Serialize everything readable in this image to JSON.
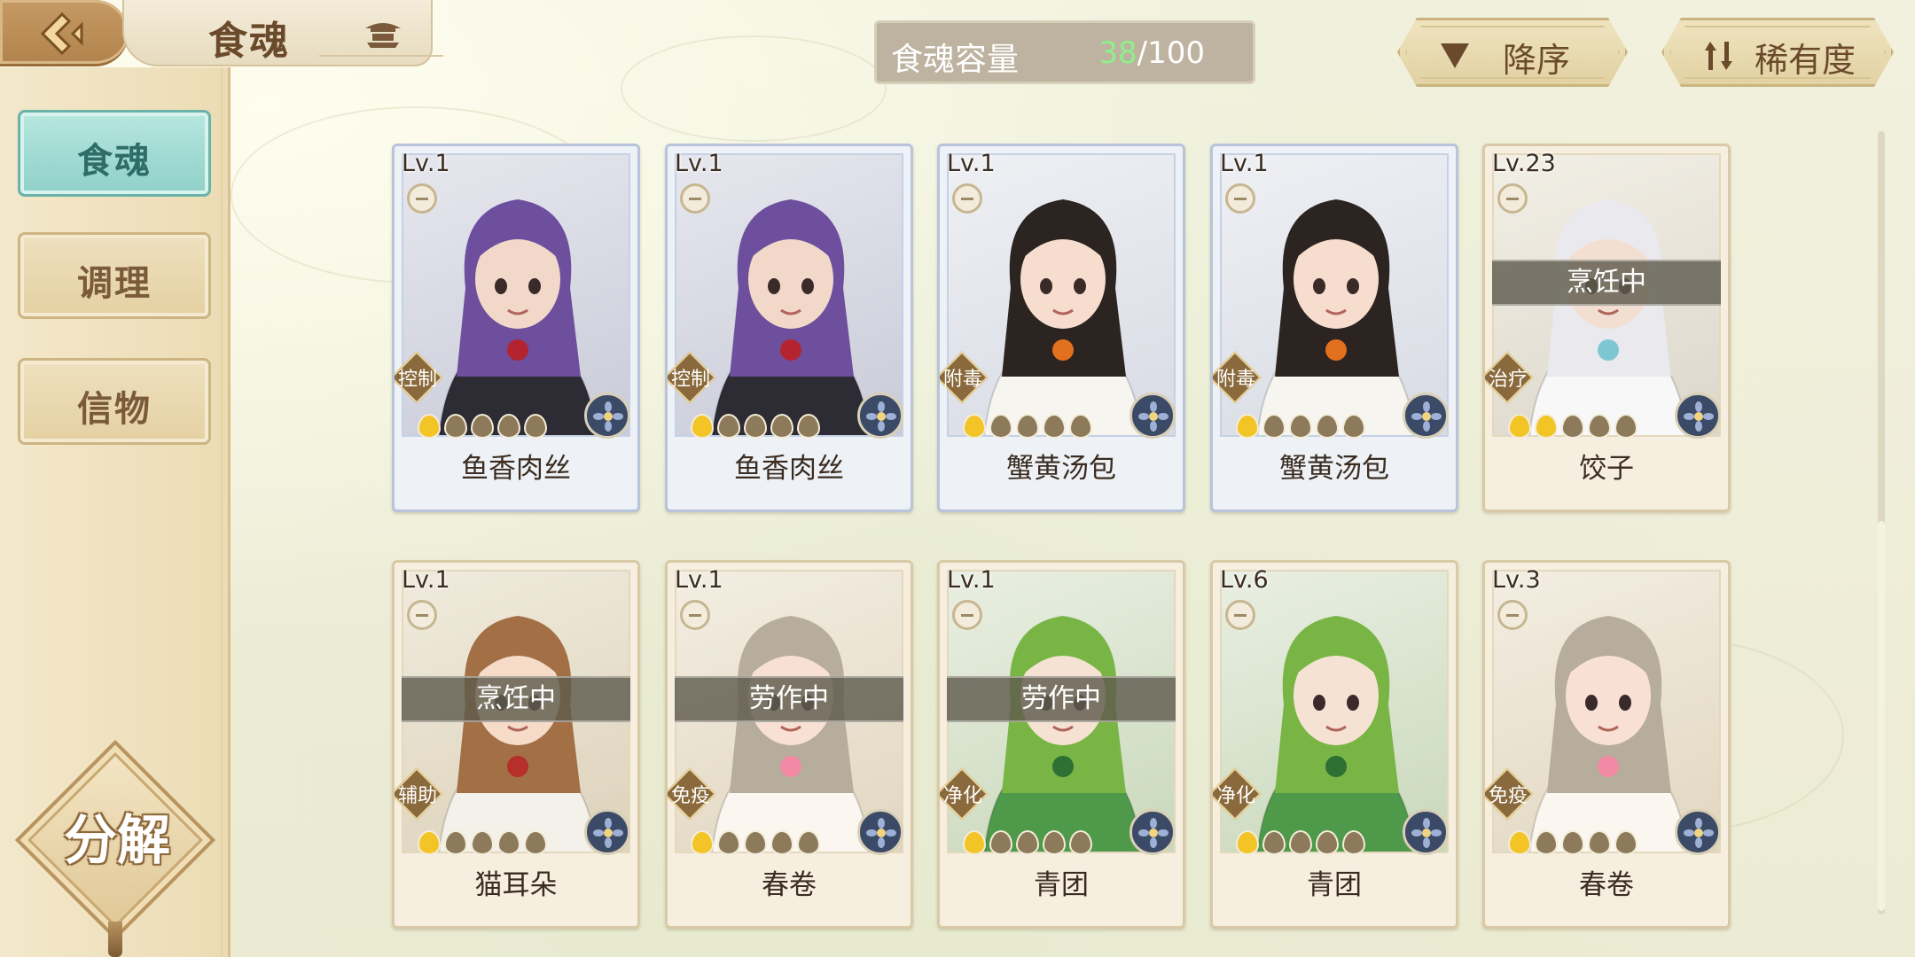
{
  "header": {
    "title": "食魂",
    "capacity_label": "食魂容量",
    "capacity_current": "38",
    "capacity_max": "/100",
    "sort_label": "降序",
    "rarity_label": "稀有度"
  },
  "sidebar": {
    "tabs": [
      {
        "label": "食魂",
        "active": true
      },
      {
        "label": "调理",
        "active": false
      },
      {
        "label": "信物",
        "active": false
      }
    ],
    "decompose_label": "分解"
  },
  "cards": [
    {
      "level": "Lv.1",
      "name": "鱼香肉丝",
      "role": "控制",
      "stars_lit": 1,
      "status": "",
      "frame": "blue",
      "art": "purple"
    },
    {
      "level": "Lv.1",
      "name": "鱼香肉丝",
      "role": "控制",
      "stars_lit": 1,
      "status": "",
      "frame": "blue",
      "art": "purple"
    },
    {
      "level": "Lv.1",
      "name": "蟹黄汤包",
      "role": "附毒",
      "stars_lit": 1,
      "status": "",
      "frame": "blue",
      "art": "hood"
    },
    {
      "level": "Lv.1",
      "name": "蟹黄汤包",
      "role": "附毒",
      "stars_lit": 1,
      "status": "",
      "frame": "blue",
      "art": "hood"
    },
    {
      "level": "Lv.23",
      "name": "饺子",
      "role": "治疗",
      "stars_lit": 2,
      "status": "烹饪中",
      "frame": "gold",
      "art": "white"
    },
    {
      "level": "Lv.1",
      "name": "猫耳朵",
      "role": "辅助",
      "stars_lit": 1,
      "status": "烹饪中",
      "frame": "gold",
      "art": "cat"
    },
    {
      "level": "Lv.1",
      "name": "春卷",
      "role": "免疫",
      "stars_lit": 1,
      "status": "劳作中",
      "frame": "gold",
      "art": "flower"
    },
    {
      "level": "Lv.1",
      "name": "青团",
      "role": "净化",
      "stars_lit": 1,
      "status": "劳作中",
      "frame": "gold",
      "art": "green"
    },
    {
      "level": "Lv.6",
      "name": "青团",
      "role": "净化",
      "stars_lit": 1,
      "status": "",
      "frame": "gold",
      "art": "green"
    },
    {
      "level": "Lv.3",
      "name": "春卷",
      "role": "免疫",
      "stars_lit": 1,
      "status": "",
      "frame": "gold",
      "art": "flower"
    }
  ],
  "icons": {
    "back": "back-arrow-icon",
    "pagoda": "pagoda-icon",
    "sort": "triangle-down-icon",
    "rarity": "swap-arrows-icon",
    "element": "flower-emblem-icon",
    "flame": "flame-icon"
  },
  "colors": {
    "capacity_current": "#8ff08a",
    "active_tab": "#8fd0c8",
    "flame_lit": "#f2c425",
    "flame_unlit": "#8d7a5a"
  }
}
